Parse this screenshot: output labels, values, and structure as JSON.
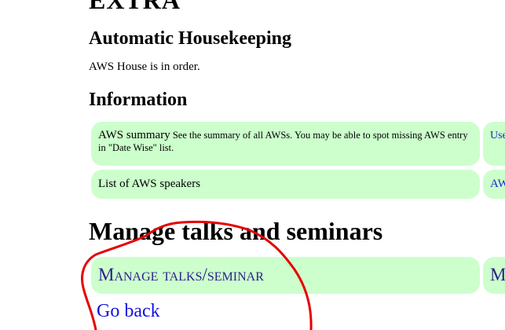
{
  "sections": {
    "extra_heading": "EXTRA",
    "housekeeping": {
      "heading": "Automatic Housekeeping",
      "status": "AWS House is in order."
    },
    "information": {
      "heading": "Information",
      "rows": [
        {
          "link": "AWS summary",
          "description": "See the summary of all AWSs. You may be able to spot missing AWS entry in \"Date Wise\" list.",
          "right_text": "Use Dat"
        },
        {
          "link": "List of AWS speakers",
          "right_text": "AW"
        }
      ]
    },
    "manage": {
      "heading": "Manage talks and seminars",
      "button": "Manage talks/seminar",
      "right_text": "M"
    }
  },
  "go_back": "Go back",
  "colors": {
    "cell_bg": "#ccffcc",
    "link_blue": "#1010e6",
    "manage_text": "#2a1f8c",
    "annotation_red": "#e60000"
  }
}
